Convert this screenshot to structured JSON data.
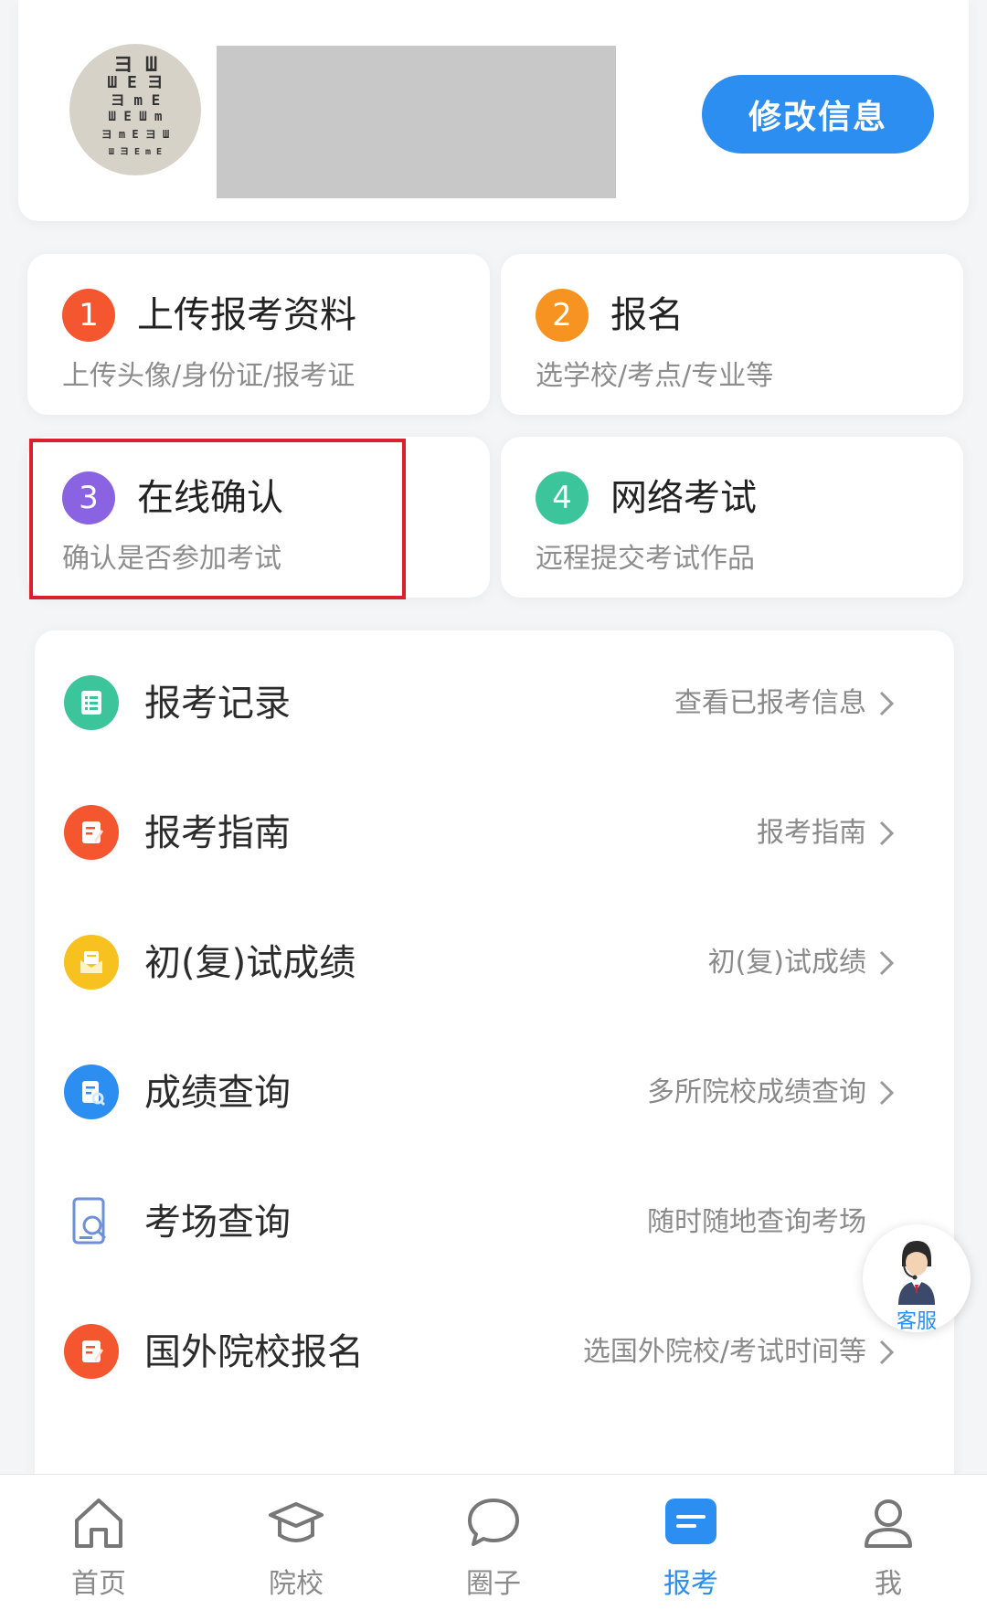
{
  "profile": {
    "edit_button": "修改信息",
    "avatar_chart_rows": [
      "ヨ Ш",
      "Ш E ヨ",
      "ヨ m E",
      "Ш E Ш m",
      "ヨ m E ヨ Ш",
      "Ш ヨ E m E"
    ]
  },
  "steps": [
    {
      "number": "1",
      "title": "上传报考资料",
      "subtitle": "上传头像/身份证/报考证",
      "color": "#f4572f"
    },
    {
      "number": "2",
      "title": "报名",
      "subtitle": "选学校/考点/专业等",
      "color": "#f79421"
    },
    {
      "number": "3",
      "title": "在线确认",
      "subtitle": "确认是否参加考试",
      "color": "#8a63e3"
    },
    {
      "number": "4",
      "title": "网络考试",
      "subtitle": "远程提交考试作品",
      "color": "#3cc59a"
    }
  ],
  "list": [
    {
      "title": "报考记录",
      "hint": "查看已报考信息",
      "icon": "record-list-icon",
      "color": "#3cc59a"
    },
    {
      "title": "报考指南",
      "hint": "报考指南",
      "icon": "guide-edit-icon",
      "color": "#f4572f"
    },
    {
      "title": "初(复)试成绩",
      "hint": "初(复)试成绩",
      "icon": "score-envelope-icon",
      "color": "#f7c21f"
    },
    {
      "title": "成绩查询",
      "hint": "多所院校成绩查询",
      "icon": "score-search-icon",
      "color": "#2b8ef0"
    },
    {
      "title": "考场查询",
      "hint": "随时随地查询考场",
      "icon": "exam-room-search-icon",
      "color": "#4a7fd6"
    },
    {
      "title": "国外院校报名",
      "hint": "选国外院校/考试时间等",
      "icon": "foreign-apply-icon",
      "color": "#f4572f"
    }
  ],
  "service": {
    "label": "客服"
  },
  "tabs": [
    {
      "label": "首页",
      "icon": "home-icon"
    },
    {
      "label": "院校",
      "icon": "school-icon"
    },
    {
      "label": "圈子",
      "icon": "chat-bubble-icon"
    },
    {
      "label": "报考",
      "icon": "apply-icon",
      "active": true
    },
    {
      "label": "我",
      "icon": "user-icon"
    }
  ],
  "colors": {
    "accent": "#2b8ef0",
    "highlight": "#d8202e"
  }
}
